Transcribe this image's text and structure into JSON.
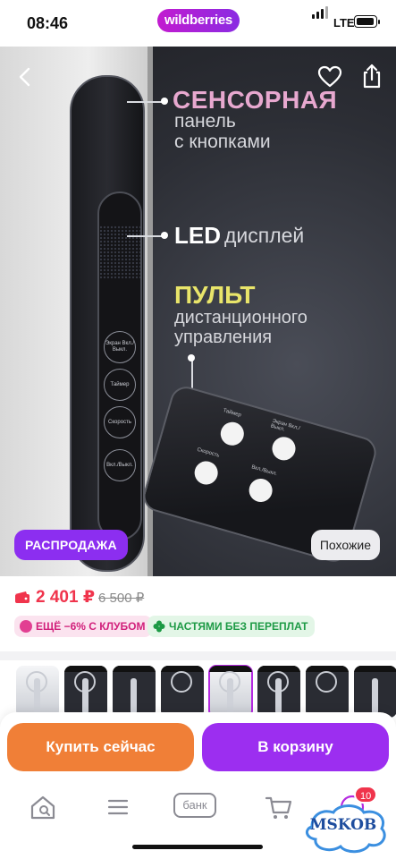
{
  "status_bar": {
    "time": "08:46",
    "brand": "wildberries",
    "network": "LTE"
  },
  "hero": {
    "sensor_title": "СЕНСОРНАЯ",
    "sensor_sub1": "панель",
    "sensor_sub2": "с кнопками",
    "led_bold": "LED",
    "led_rest": "дисплей",
    "remote_title": "ПУЛЬТ",
    "remote_sub1": "дистанционного",
    "remote_sub2": "управления",
    "panel_buttons": [
      "Экран Вкл./Выкл.",
      "Таймер",
      "Скорость",
      "Вкл./Выкл."
    ],
    "remote_labels": [
      "Таймер",
      "Экран Вкл./Выкл.",
      "Скорость",
      "Вкл./Выкл."
    ],
    "sale_badge": "РАСПРОДАЖА",
    "similar_button": "Похожие"
  },
  "price": {
    "current": "2 401 ₽",
    "old": "6 500 ₽"
  },
  "tags": {
    "club": "ЕЩЁ −6% С КЛУБОМ",
    "installments": "ЧАСТЯМИ БЕЗ ПЕРЕПЛАТ"
  },
  "thumbnails_count": 8,
  "actions": {
    "buy_now": "Купить сейчас",
    "to_cart": "В корзину"
  },
  "tabbar": {
    "bank": "банк",
    "cart_badge": "10"
  },
  "watermark": "MSKOB",
  "colors": {
    "brand": "#9c2ef0",
    "buy_now": "#f07f37",
    "price": "#f0344c"
  }
}
